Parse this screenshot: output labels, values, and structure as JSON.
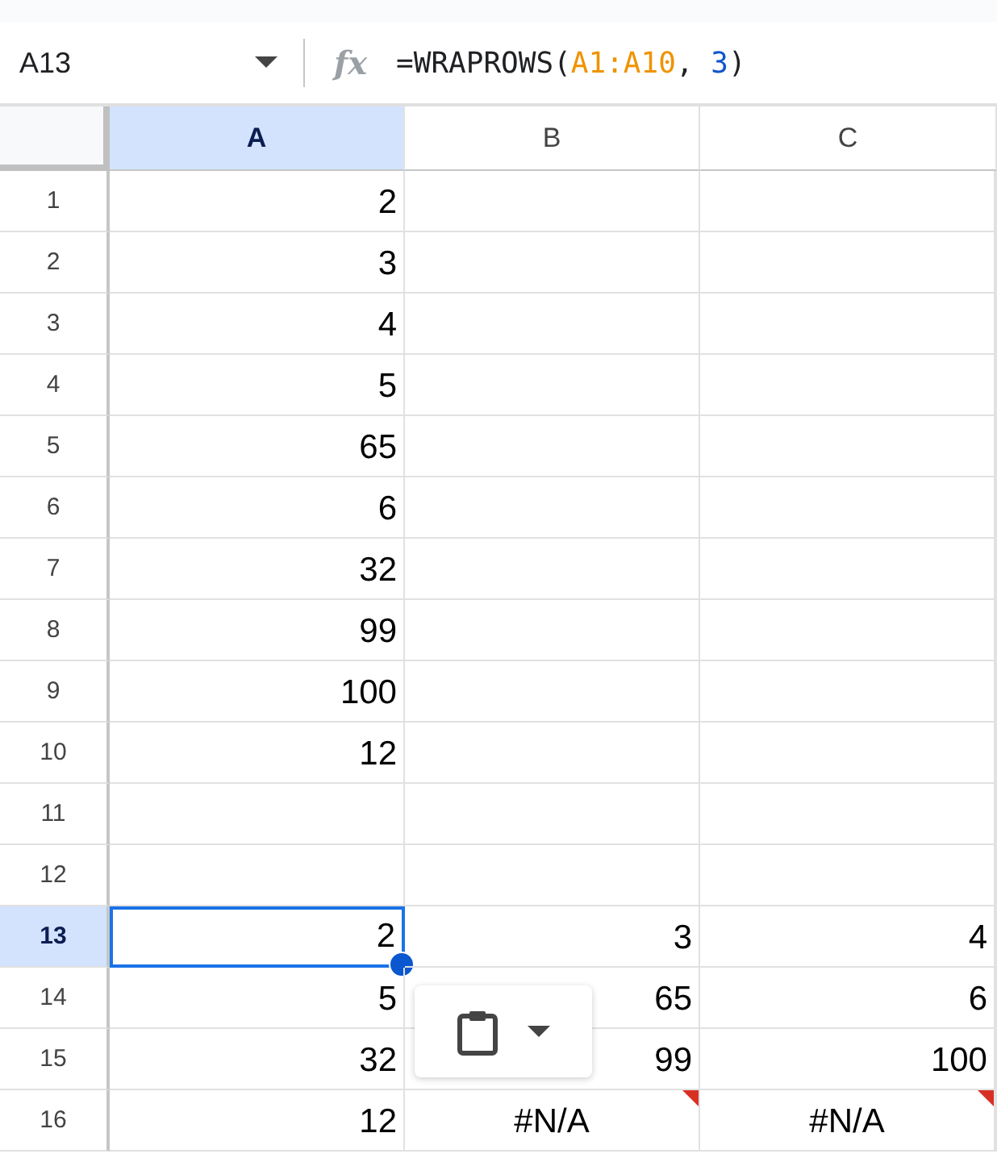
{
  "name_box": {
    "value": "A13"
  },
  "formula_bar": {
    "icon": "fx",
    "parts": [
      {
        "text": "=WRAPROWS(",
        "kind": "plain"
      },
      {
        "text": "A1:A10",
        "kind": "range"
      },
      {
        "text": ", ",
        "kind": "plain"
      },
      {
        "text": "3",
        "kind": "number"
      },
      {
        "text": ")",
        "kind": "plain"
      }
    ]
  },
  "columns": [
    {
      "label": "A",
      "selected": true
    },
    {
      "label": "B",
      "selected": false
    },
    {
      "label": "C",
      "selected": false
    }
  ],
  "rows": [
    {
      "header": "1",
      "selected": false,
      "cells": [
        {
          "value": "2",
          "selected": false
        },
        null,
        null
      ]
    },
    {
      "header": "2",
      "selected": false,
      "cells": [
        {
          "value": "3",
          "selected": false
        },
        null,
        null
      ]
    },
    {
      "header": "3",
      "selected": false,
      "cells": [
        {
          "value": "4",
          "selected": false
        },
        null,
        null
      ]
    },
    {
      "header": "4",
      "selected": false,
      "cells": [
        {
          "value": "5",
          "selected": false
        },
        null,
        null
      ]
    },
    {
      "header": "5",
      "selected": false,
      "cells": [
        {
          "value": "65",
          "selected": false
        },
        null,
        null
      ]
    },
    {
      "header": "6",
      "selected": false,
      "cells": [
        {
          "value": "6",
          "selected": false
        },
        null,
        null
      ]
    },
    {
      "header": "7",
      "selected": false,
      "cells": [
        {
          "value": "32",
          "selected": false
        },
        null,
        null
      ]
    },
    {
      "header": "8",
      "selected": false,
      "cells": [
        {
          "value": "99",
          "selected": false
        },
        null,
        null
      ]
    },
    {
      "header": "9",
      "selected": false,
      "cells": [
        {
          "value": "100",
          "selected": false
        },
        null,
        null
      ]
    },
    {
      "header": "10",
      "selected": false,
      "cells": [
        {
          "value": "12",
          "selected": false
        },
        null,
        null
      ]
    },
    {
      "header": "11",
      "selected": false,
      "cells": [
        null,
        null,
        null
      ]
    },
    {
      "header": "12",
      "selected": false,
      "cells": [
        null,
        null,
        null
      ]
    },
    {
      "header": "13",
      "selected": true,
      "cells": [
        {
          "value": "2",
          "selected": true
        },
        {
          "value": "3",
          "selected": false
        },
        {
          "value": "4",
          "selected": false
        }
      ]
    },
    {
      "header": "14",
      "selected": false,
      "cells": [
        {
          "value": "5",
          "selected": false
        },
        {
          "value": "65",
          "selected": false
        },
        {
          "value": "6",
          "selected": false
        }
      ]
    },
    {
      "header": "15",
      "selected": false,
      "cells": [
        {
          "value": "32",
          "selected": false
        },
        {
          "value": "99",
          "selected": false
        },
        {
          "value": "100",
          "selected": false
        }
      ]
    },
    {
      "header": "16",
      "selected": false,
      "cells": [
        {
          "value": "12",
          "selected": false
        },
        {
          "value": "#N/A",
          "selected": false,
          "error": true
        },
        {
          "value": "#N/A",
          "selected": false,
          "error": true
        }
      ]
    }
  ],
  "paste_popup": {
    "visible": true
  }
}
